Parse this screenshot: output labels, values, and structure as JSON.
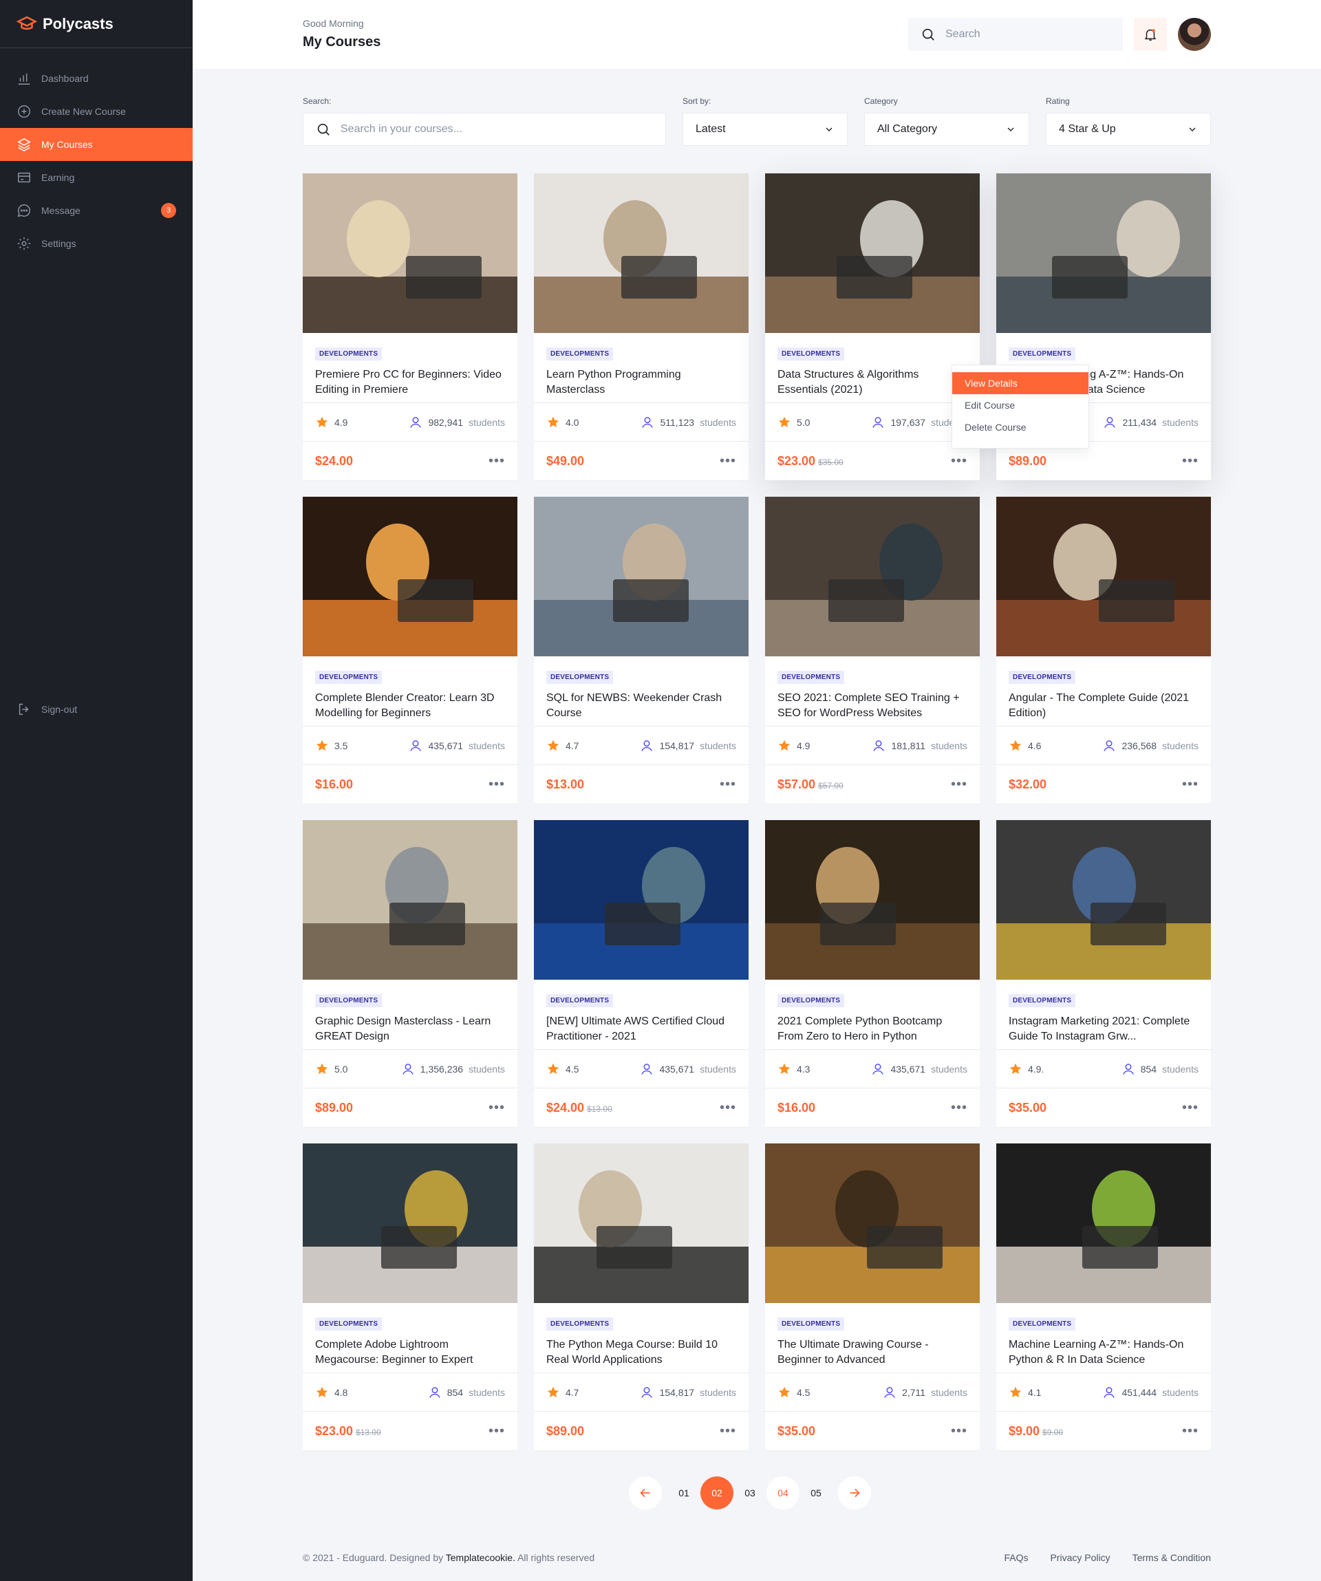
{
  "brand": {
    "name": "Polycasts"
  },
  "sidebar": {
    "items": [
      {
        "label": "Dashboard",
        "icon": "chart-bar-icon"
      },
      {
        "label": "Create New Course",
        "icon": "plus-circle-icon"
      },
      {
        "label": "My Courses",
        "icon": "stack-icon",
        "active": true
      },
      {
        "label": "Earning",
        "icon": "credit-card-icon"
      },
      {
        "label": "Message",
        "icon": "chat-icon",
        "badge": "3"
      },
      {
        "label": "Settings",
        "icon": "gear-icon"
      }
    ],
    "signout": "Sign-out"
  },
  "header": {
    "greeting": "Good Morning",
    "title": "My Courses",
    "search_placeholder": "Search"
  },
  "filters": {
    "search": {
      "label": "Search:",
      "placeholder": "Search in your courses..."
    },
    "sort": {
      "label": "Sort by:",
      "value": "Latest"
    },
    "category": {
      "label": "Category",
      "value": "All Category"
    },
    "rating": {
      "label": "Rating",
      "value": "4 Star & Up"
    }
  },
  "courses": [
    {
      "category": "DEVELOPMENTS",
      "title": "Premiere Pro CC for Beginners: Video Editing in Premiere",
      "rating": "4.9",
      "students": "982,941",
      "price": "$24.00",
      "old_price": ""
    },
    {
      "category": "DEVELOPMENTS",
      "title": "Learn Python Programming Masterclass",
      "rating": "4.0",
      "students": "511,123",
      "price": "$49.00",
      "old_price": ""
    },
    {
      "category": "DEVELOPMENTS",
      "title": "Data Structures & Algorithms Essentials (2021)",
      "rating": "5.0",
      "students": "197,637",
      "price": "$23.00",
      "old_price": "$35.00"
    },
    {
      "category": "DEVELOPMENTS",
      "title": "Machine Learning A-Z™: Hands-On Python & R In Data Science",
      "rating": "",
      "students": "211,434",
      "price": "$89.00",
      "old_price": ""
    },
    {
      "category": "DEVELOPMENTS",
      "title": "Complete Blender Creator: Learn 3D Modelling for Beginners",
      "rating": "3.5",
      "students": "435,671",
      "price": "$16.00",
      "old_price": ""
    },
    {
      "category": "DEVELOPMENTS",
      "title": "SQL for NEWBS: Weekender Crash Course",
      "rating": "4.7",
      "students": "154,817",
      "price": "$13.00",
      "old_price": ""
    },
    {
      "category": "DEVELOPMENTS",
      "title": "SEO 2021: Complete SEO Training + SEO for WordPress Websites",
      "rating": "4.9",
      "students": "181,811",
      "price": "$57.00",
      "old_price": "$57.00"
    },
    {
      "category": "DEVELOPMENTS",
      "title": "Angular - The Complete Guide (2021 Edition)",
      "rating": "4.6",
      "students": "236,568",
      "price": "$32.00",
      "old_price": ""
    },
    {
      "category": "DEVELOPMENTS",
      "title": "Graphic Design Masterclass - Learn GREAT Design",
      "rating": "5.0",
      "students": "1,356,236",
      "price": "$89.00",
      "old_price": ""
    },
    {
      "category": "DEVELOPMENTS",
      "title": "[NEW] Ultimate AWS Certified Cloud Practitioner - 2021",
      "rating": "4.5",
      "students": "435,671",
      "price": "$24.00",
      "old_price": "$13.00"
    },
    {
      "category": "DEVELOPMENTS",
      "title": "2021 Complete Python Bootcamp From Zero to Hero in Python",
      "rating": "4.3",
      "students": "435,671",
      "price": "$16.00",
      "old_price": ""
    },
    {
      "category": "DEVELOPMENTS",
      "title": "Instagram Marketing 2021: Complete Guide To Instagram Grw...",
      "rating": "4.9.",
      "students": "854",
      "price": "$35.00",
      "old_price": ""
    },
    {
      "category": "DEVELOPMENTS",
      "title": "Complete Adobe Lightroom Megacourse: Beginner to Expert",
      "rating": "4.8",
      "students": "854",
      "price": "$23.00",
      "old_price": "$13.00"
    },
    {
      "category": "DEVELOPMENTS",
      "title": "The Python Mega Course: Build 10 Real World Applications",
      "rating": "4.7",
      "students": "154,817",
      "price": "$89.00",
      "old_price": ""
    },
    {
      "category": "DEVELOPMENTS",
      "title": "The Ultimate Drawing Course - Beginner to Advanced",
      "rating": "4.5",
      "students": "2,711",
      "price": "$35.00",
      "old_price": ""
    },
    {
      "category": "DEVELOPMENTS",
      "title": "Machine Learning A-Z™: Hands-On Python & R In Data Science",
      "rating": "4.1",
      "students": "451,444",
      "price": "$9.00",
      "old_price": "$9.00"
    }
  ],
  "students_label": "students",
  "context_menu": {
    "items": [
      "View Details",
      "Edit Course",
      "Delete Course"
    ]
  },
  "pagination": {
    "pages": [
      "01",
      "02",
      "03",
      "04",
      "05"
    ],
    "current": "02"
  },
  "footer": {
    "copyright_prefix": "© 2021 - Eduguard. Designed by",
    "designer": "Templatecookie.",
    "copyright_suffix": "All rights reserved",
    "links": [
      "FAQs",
      "Privacy Policy",
      "Terms & Condition"
    ]
  },
  "colors": {
    "accent": "#ff6636",
    "sidebar_bg": "#1d2026",
    "badge_bg": "#ebebff",
    "badge_text": "#342f98",
    "star": "#fd8e1f",
    "students_icon": "#564ffd"
  }
}
